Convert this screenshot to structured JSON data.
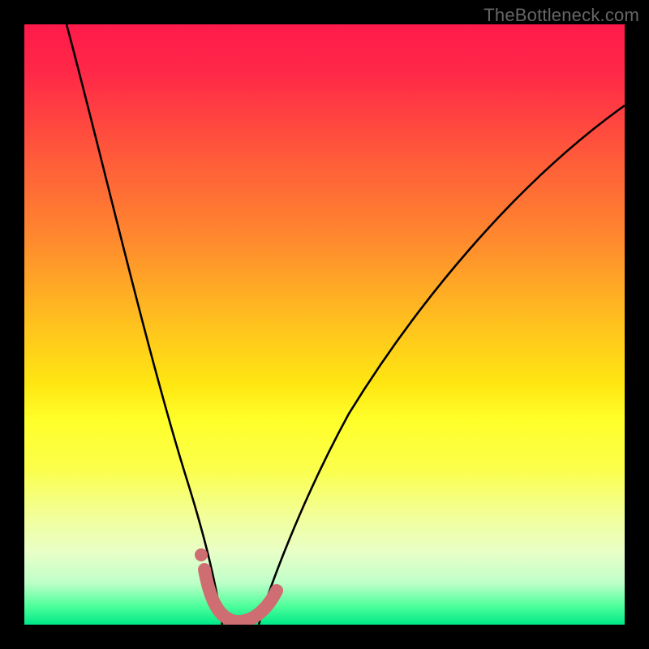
{
  "watermark": "TheBottleneck.com",
  "chart_data": {
    "type": "line",
    "title": "",
    "xlabel": "",
    "ylabel": "",
    "xlim": [
      0,
      100
    ],
    "ylim": [
      0,
      100
    ],
    "series": [
      {
        "name": "left-curve",
        "x": [
          7,
          10,
          14,
          18,
          22,
          26,
          28,
          30,
          32,
          33
        ],
        "values": [
          100,
          86,
          68,
          50,
          33,
          17,
          10,
          5,
          2,
          0
        ]
      },
      {
        "name": "right-curve",
        "x": [
          39,
          41,
          44,
          48,
          54,
          62,
          72,
          84,
          100
        ],
        "values": [
          0,
          4,
          10,
          18,
          30,
          44,
          58,
          71,
          86
        ]
      },
      {
        "name": "highlight-arc",
        "x": [
          30,
          31,
          33,
          36,
          39,
          41,
          42
        ],
        "values": [
          9,
          4,
          1,
          0,
          1,
          3,
          5
        ]
      },
      {
        "name": "highlight-dot",
        "x": [
          29.5
        ],
        "values": [
          12
        ]
      }
    ],
    "colors": {
      "curve": "#000000",
      "highlight": "#cf6e72"
    },
    "background_gradient": {
      "top": "#ff1a4a",
      "middle": "#ffe712",
      "bottom": "#00e887"
    }
  }
}
